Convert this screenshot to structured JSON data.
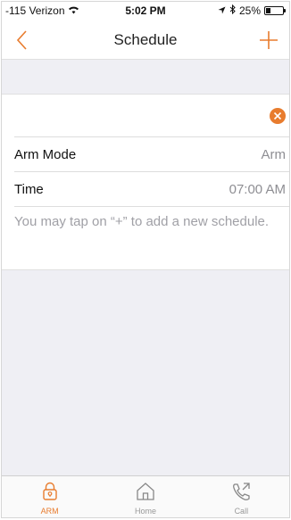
{
  "status_bar": {
    "carrier": "-115 Verizon",
    "time": "5:02 PM",
    "battery": "25%",
    "battery_level": 0.25
  },
  "nav": {
    "title": "Schedule",
    "back_icon": "chevron-left-icon",
    "add_icon": "plus-icon"
  },
  "schedule_item": {
    "delete_icon": "close-circle-icon",
    "rows": [
      {
        "label": "Arm Mode",
        "value": "Arm"
      },
      {
        "label": "Time",
        "value": "07:00 AM"
      }
    ]
  },
  "hint": "You may tap on “+” to add a new schedule.",
  "tabs": [
    {
      "label": "ARM",
      "icon": "lock-icon",
      "active": true
    },
    {
      "label": "Home",
      "icon": "home-icon",
      "active": false
    },
    {
      "label": "Call",
      "icon": "phone-icon",
      "active": false
    }
  ],
  "colors": {
    "accent": "#e87c2e",
    "background_gray": "#efeff4"
  }
}
